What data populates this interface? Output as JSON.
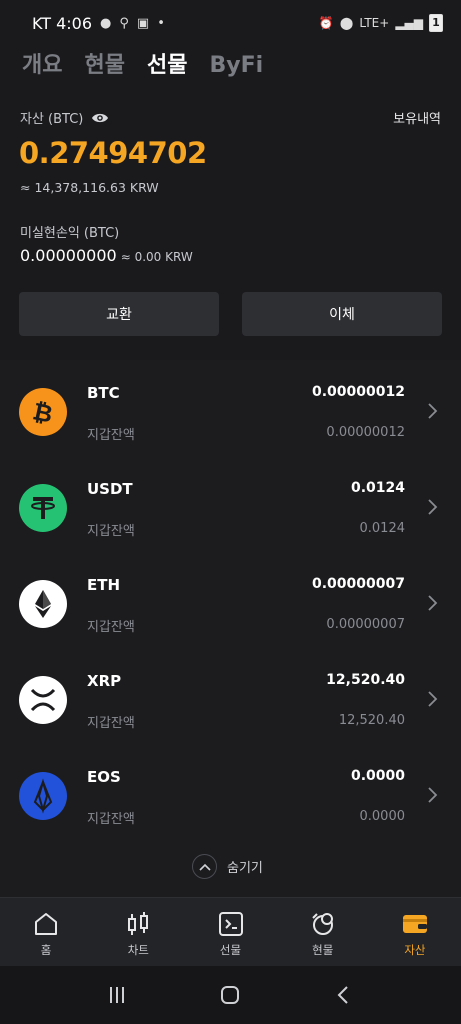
{
  "status_bar": {
    "carrier_time": "KT 4:06",
    "network": "LTE+",
    "battery": "1"
  },
  "tabs": [
    {
      "label": "개요",
      "active": false
    },
    {
      "label": "현물",
      "active": false
    },
    {
      "label": "선물",
      "active": true
    },
    {
      "label": "ByFi",
      "active": false
    }
  ],
  "summary": {
    "asset_label": "자산 (BTC)",
    "holdings_link": "보유내역",
    "asset_value": "0.27494702",
    "asset_krw": "≈ 14,378,116.63 KRW",
    "pnl_label": "미실현손익 (BTC)",
    "pnl_value": "0.00000000",
    "pnl_krw": "≈ 0.00 KRW"
  },
  "buttons": {
    "exchange": "교환",
    "transfer": "이체"
  },
  "coins": [
    {
      "symbol": "BTC",
      "sub_label": "지갑잔액",
      "balance": "0.00000012",
      "wallet": "0.00000012",
      "icon": "btc-icon",
      "color": "#f7931a"
    },
    {
      "symbol": "USDT",
      "sub_label": "지갑잔액",
      "balance": "0.0124",
      "wallet": "0.0124",
      "icon": "usdt-icon",
      "color": "#26c273"
    },
    {
      "symbol": "ETH",
      "sub_label": "지갑잔액",
      "balance": "0.00000007",
      "wallet": "0.00000007",
      "icon": "eth-icon",
      "color": "#ffffff"
    },
    {
      "symbol": "XRP",
      "sub_label": "지갑잔액",
      "balance": "12,520.40",
      "wallet": "12,520.40",
      "icon": "xrp-icon",
      "color": "#ffffff"
    },
    {
      "symbol": "EOS",
      "sub_label": "지갑잔액",
      "balance": "0.0000",
      "wallet": "0.0000",
      "icon": "eos-icon",
      "color": "#2152d9"
    }
  ],
  "hide_label": "숨기기",
  "bottom_nav": [
    {
      "label": "홈",
      "icon": "home-icon",
      "active": false
    },
    {
      "label": "차트",
      "icon": "chart-icon",
      "active": false
    },
    {
      "label": "선물",
      "icon": "futures-icon",
      "active": false
    },
    {
      "label": "현물",
      "icon": "spot-icon",
      "active": false
    },
    {
      "label": "자산",
      "icon": "wallet-icon",
      "active": true
    }
  ],
  "colors": {
    "accent": "#f5a623",
    "background": "#1c1c1f",
    "panel": "#1a1a1d",
    "button": "#2e2f33"
  }
}
